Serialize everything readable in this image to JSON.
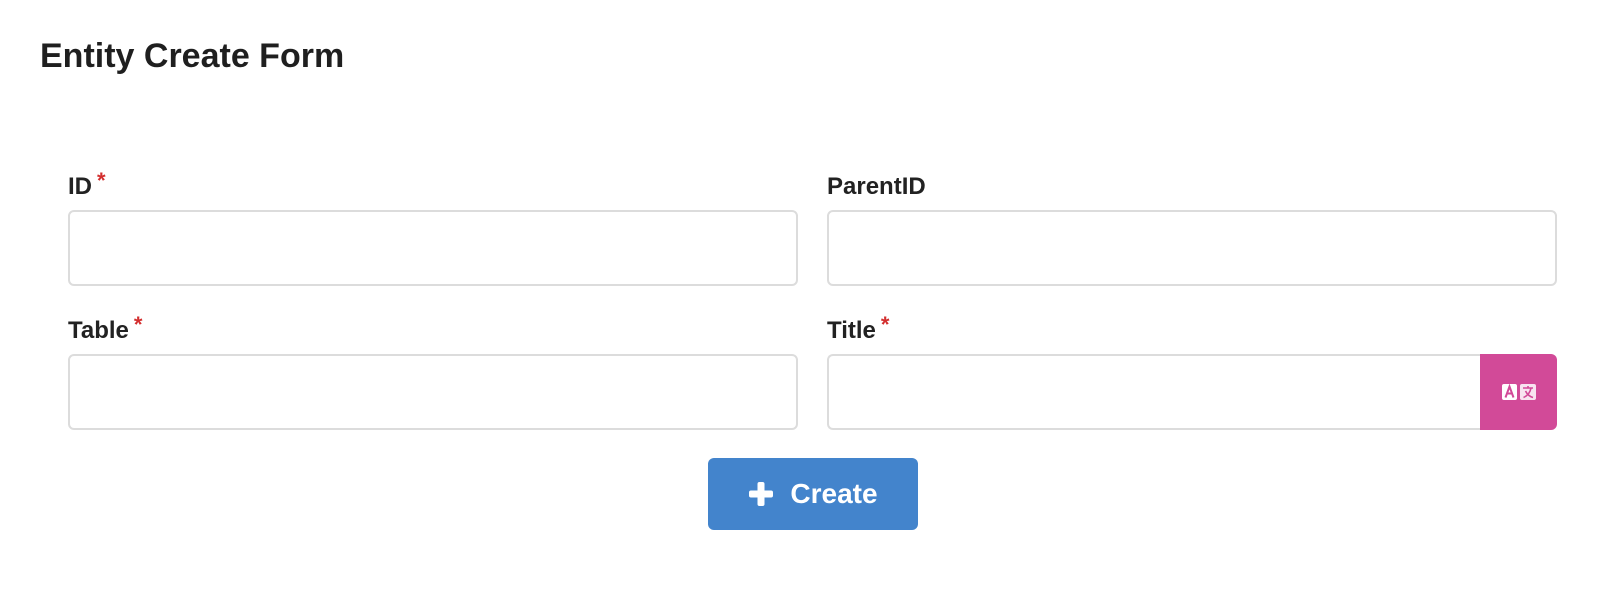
{
  "page": {
    "title": "Entity Create Form"
  },
  "form": {
    "fields": {
      "id": {
        "label": "ID",
        "required_mark": "*",
        "value": "",
        "placeholder": ""
      },
      "parent_id": {
        "label": "ParentID",
        "value": "",
        "placeholder": ""
      },
      "table": {
        "label": "Table",
        "required_mark": "*",
        "value": "",
        "placeholder": ""
      },
      "title": {
        "label": "Title",
        "required_mark": "*",
        "value": "",
        "placeholder": ""
      }
    },
    "translate_button": {
      "icon": "translate-icon",
      "color": "#d24a98"
    },
    "create_button": {
      "label": "Create",
      "icon": "plus-icon",
      "color": "#4384cc"
    }
  },
  "colors": {
    "required": "#d32f2f",
    "input_border": "#dcdcdc"
  }
}
